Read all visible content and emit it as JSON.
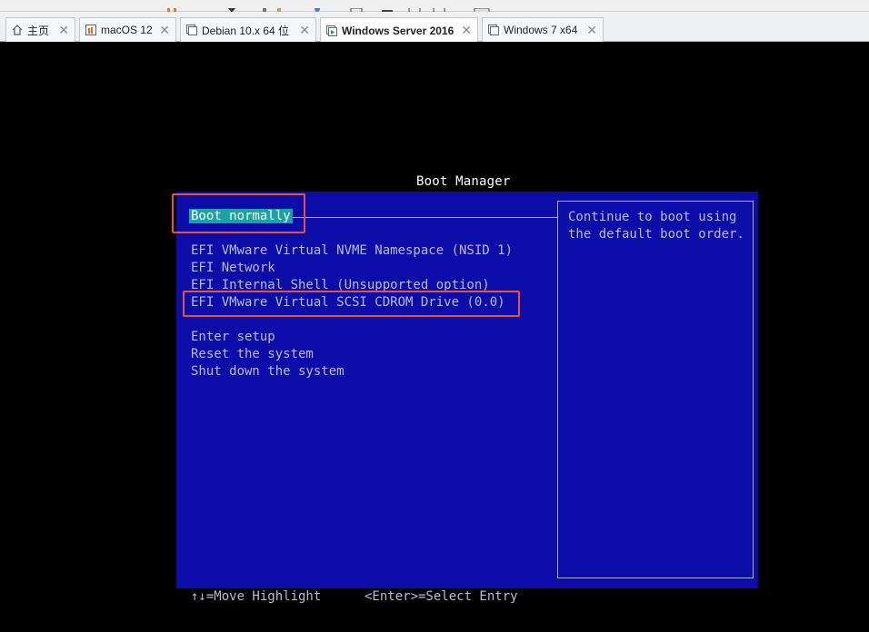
{
  "tabs": [
    {
      "label": "主页",
      "icon": "home-icon",
      "active": false
    },
    {
      "label": "macOS 12",
      "icon": "vm-icon",
      "active": false
    },
    {
      "label": "Debian 10.x 64 位",
      "icon": "vm-icon",
      "active": false
    },
    {
      "label": "Windows Server 2016",
      "icon": "vm-icon",
      "active": true
    },
    {
      "label": "Windows 7 x64",
      "icon": "vm-icon",
      "active": false
    }
  ],
  "close_glyph": "✕",
  "boot_manager": {
    "title": "Boot Manager",
    "selected": "Boot normally",
    "devices": [
      "EFI VMware Virtual NVME Namespace (NSID 1)",
      "EFI Network",
      "EFI Internal Shell (Unsupported option)",
      "EFI VMware Virtual SCSI CDROM Drive (0.0)"
    ],
    "actions": [
      "Enter setup",
      "Reset the system",
      "Shut down the system"
    ],
    "description": "Continue to boot using\nthe default boot order.",
    "footer_left": "↑↓=Move Highlight",
    "footer_right": "<Enter>=Select Entry"
  },
  "colors": {
    "panel_bg": "#0c0ca8",
    "highlight": "#1aa3a3",
    "annotation": "#e5533d"
  }
}
